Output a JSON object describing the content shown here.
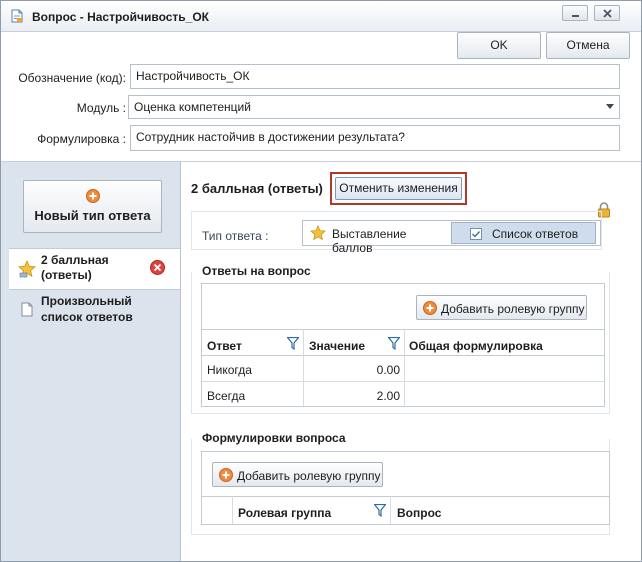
{
  "window": {
    "title": "Вопрос - Настройчивость_ОК"
  },
  "toolbar": {
    "ok_label": "OK",
    "cancel_label": "Отмена"
  },
  "form": {
    "code_label": "Обозначение (код):",
    "code_value": "Настройчивость_ОК",
    "module_label": "Модуль :",
    "module_value": "Оценка компетенций",
    "wording_label": "Формулировка :",
    "wording_value": "Сотрудник настойчив в достижении результата?"
  },
  "sidebar": {
    "new_type_label": "Новый тип ответа",
    "items": [
      {
        "label_line1": "2 балльная",
        "label_line2": "(ответы)"
      },
      {
        "label_line1": "Произвольный",
        "label_line2": "список ответов"
      }
    ]
  },
  "main": {
    "heading": "2 балльная (ответы)",
    "cancel_changes_label": "Отменить изменения",
    "answer_type_label": "Тип ответа :",
    "answer_type_options": [
      "Выставление баллов",
      "Список ответов"
    ],
    "answers_section_title": "Ответы на вопрос",
    "add_role_group_label": "Добавить ролевую группу",
    "answers_columns": [
      "Ответ",
      "Значение",
      "Общая формулировка"
    ],
    "answers_rows": [
      {
        "answer": "Никогда",
        "value": "0.00",
        "wording": ""
      },
      {
        "answer": "Всегда",
        "value": "2.00",
        "wording": ""
      }
    ],
    "wordings_section_title": "Формулировки вопроса",
    "add_role_group_label_2": "Добавить ролевую группу",
    "wordings_columns": [
      "Ролевая группа",
      "Вопрос"
    ]
  },
  "colors": {
    "accent_red": "#b5372a",
    "sidebar_bg": "#dbe3ec",
    "selected_option": "#cfdceb"
  }
}
